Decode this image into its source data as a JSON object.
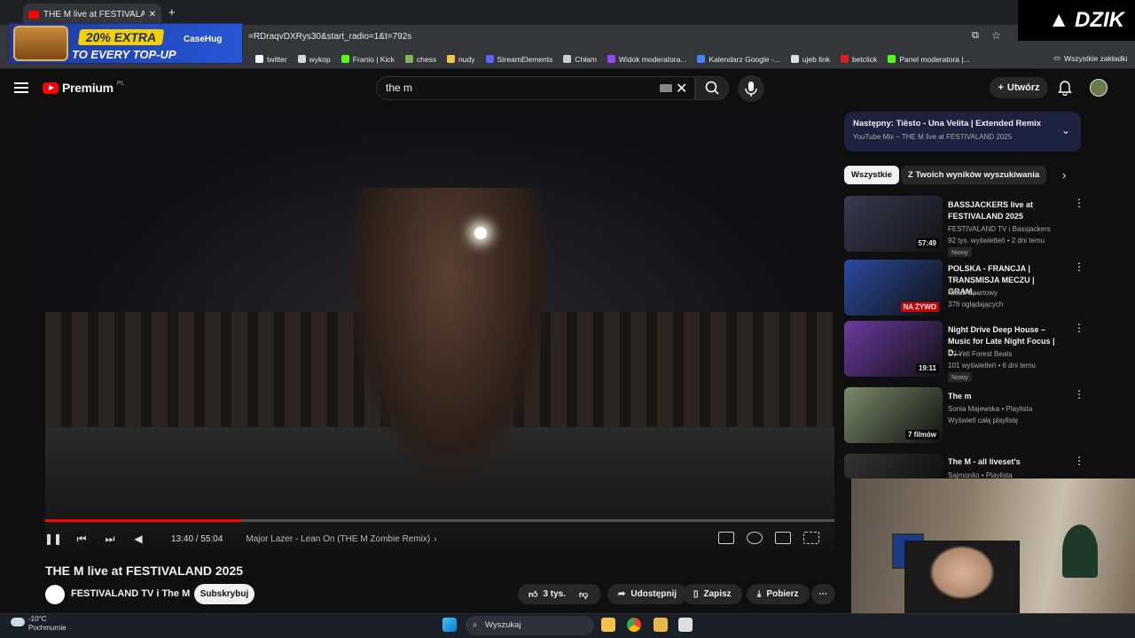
{
  "browser": {
    "tab_title": "THE M live at FESTIVALAND",
    "url": "=RDraqvDXRys30&start_radio=1&t=792s",
    "bookmarks": [
      {
        "label": "twitter",
        "color": "#ffffff"
      },
      {
        "label": "wykop",
        "color": "#d5d5d5"
      },
      {
        "label": "Franio | Kick",
        "color": "#53fc18"
      },
      {
        "label": "chess",
        "color": "#81b64c"
      },
      {
        "label": "nudy",
        "color": "#f5c542"
      },
      {
        "label": "StreamElements",
        "color": "#5f5fff"
      },
      {
        "label": "Chłam",
        "color": "#cccccc"
      },
      {
        "label": "Widok moderatora...",
        "color": "#9146ff"
      },
      {
        "label": "Kalendarz Google -...",
        "color": "#4285f4"
      },
      {
        "label": "ujeb link",
        "color": "#dddddd"
      },
      {
        "label": "betclick",
        "color": "#e11b22"
      },
      {
        "label": "Panel moderatora |...",
        "color": "#53fc18"
      }
    ],
    "all_bookmarks": "Wszystkie zakładki"
  },
  "ad": {
    "pill": "20% EXTRA",
    "line2": "TO EVERY TOP-UP",
    "brand": "CaseHug"
  },
  "overlay_logo": "DZIK",
  "header": {
    "logo": "Premium",
    "region": "PL",
    "search_value": "the m",
    "create_label": "Utwórz"
  },
  "player": {
    "progress": 0.248,
    "time": "13:40 / 55:04",
    "chapter": "Major Lazer - Lean On (THE M Zombie Remix)"
  },
  "video": {
    "title": "THE M live at FESTIVALAND 2025",
    "channel": "FESTIVALAND TV i The M",
    "subscribe": "Subskrybuj",
    "likes": "3 tys.",
    "share": "Udostępnij",
    "save": "Zapisz",
    "download": "Pobierz"
  },
  "sidebar": {
    "next_label": "Następny: Tiësto - Una Velita | Extended Remix",
    "next_sub": "YouTube Mix – THE M live at FESTIVALAND 2025",
    "chips": [
      "Wszystkie",
      "Z Twoich wyników wyszukiwania"
    ],
    "items": [
      {
        "title": "BASSJACKERS live at FESTIVALAND 2025",
        "channel": "FESTIVALAND TV i Bassjackers",
        "meta": "92 tys. wyświetleń • 2 dni temu",
        "badge": "Nowy",
        "duration": "57:49",
        "color": "#3a3a52"
      },
      {
        "title": "POLSKA - FRANCJA | TRANSMISJA MECZU | GRAM...",
        "channel": "Kanał Sportowy",
        "meta": "376 oglądających",
        "badge": "",
        "duration": "NA ŻYWO",
        "color": "#2b4aa0"
      },
      {
        "title": "Night Drive Deep House – Music for Late Night Focus | D...",
        "channel": "DJ Yeti Forest Beats",
        "meta": "101 wyświetleń • 6 dni temu",
        "badge": "Nowy",
        "duration": "19:11",
        "color": "#6a3aa0"
      },
      {
        "title": "The m",
        "channel": "Sonia Majewska • Playlista",
        "meta": "Wyświetl całą playlistę",
        "badge": "",
        "duration": "7 filmów",
        "color": "#7a8a6a"
      },
      {
        "title": "The M - all liveset's",
        "channel": "Sajmonito • Playlista",
        "meta": "",
        "badge": "",
        "duration": "",
        "color": "#333333"
      }
    ]
  },
  "taskbar": {
    "temp": "-10°C",
    "weather": "Pochmurnie",
    "search": "Wyszukaj"
  }
}
